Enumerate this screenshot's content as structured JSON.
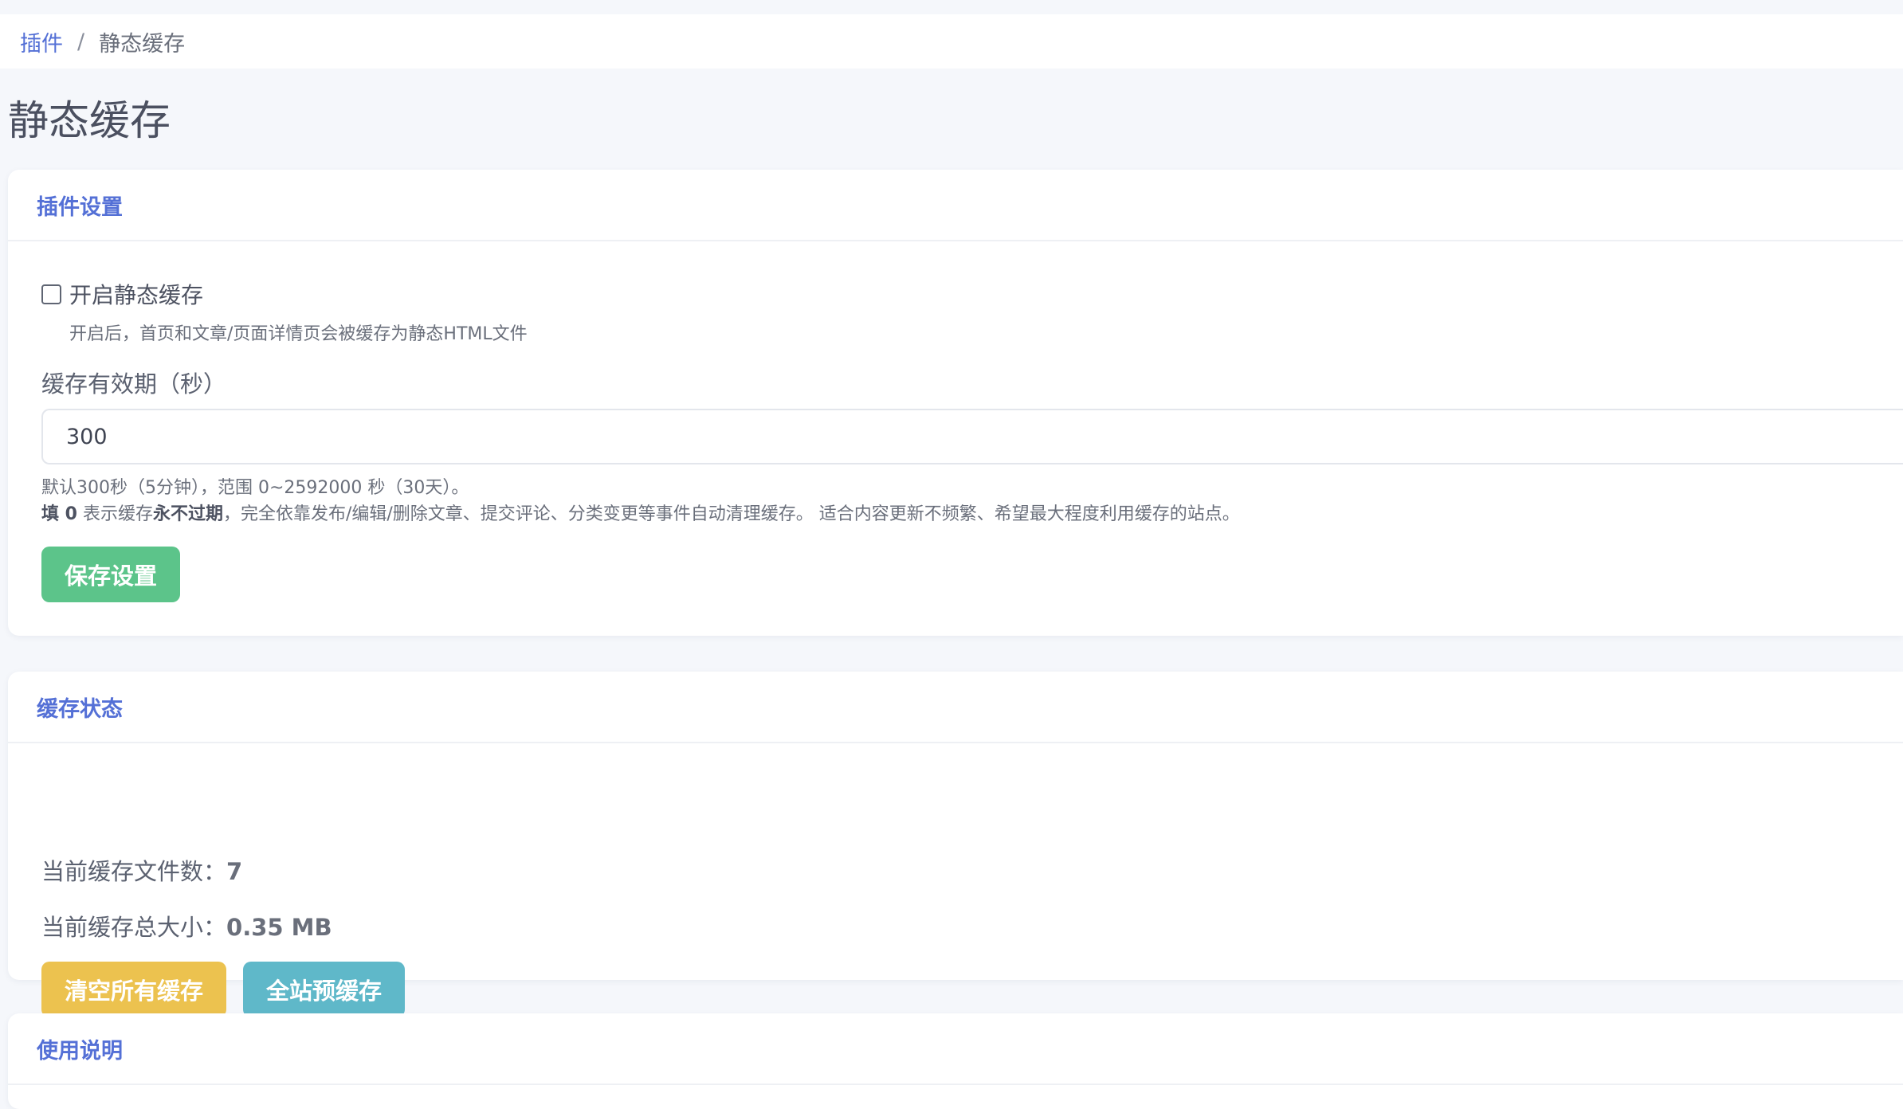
{
  "breadcrumb": {
    "parent": "插件",
    "separator": "/",
    "current": "静态缓存"
  },
  "page_title": "静态缓存",
  "settings_card": {
    "title": "插件设置",
    "enable_checkbox": {
      "label": "开启静态缓存",
      "checked": false,
      "help": "开启后，首页和文章/页面详情页会被缓存为静态HTML文件"
    },
    "ttl_field": {
      "label": "缓存有效期（秒）",
      "value": "300"
    },
    "help_line_1": "默认300秒（5分钟），范围 0~2592000 秒（30天）。",
    "help_line_2": {
      "strong_prefix": "填 0",
      "text_a": " 表示缓存",
      "strong_mid": "永不过期",
      "text_b": "，完全依靠发布/编辑/删除文章、提交评论、分类变更等事件自动清理缓存。 适合内容更新不频繁、希望最大程度利用缓存的站点。"
    },
    "save_button": "保存设置"
  },
  "status_card": {
    "title": "缓存状态",
    "file_count_label": "当前缓存文件数：",
    "file_count_value": "7",
    "total_size_label": "当前缓存总大小：",
    "total_size_value": "0.35 MB",
    "clear_button": "清空所有缓存",
    "preload_button": "全站预缓存"
  },
  "usage_card": {
    "title": "使用说明"
  },
  "colors": {
    "accent": "#5470d6",
    "save_button": "#5cc48a",
    "clear_button": "#ecc24f",
    "preload_button": "#5fb8c9"
  }
}
